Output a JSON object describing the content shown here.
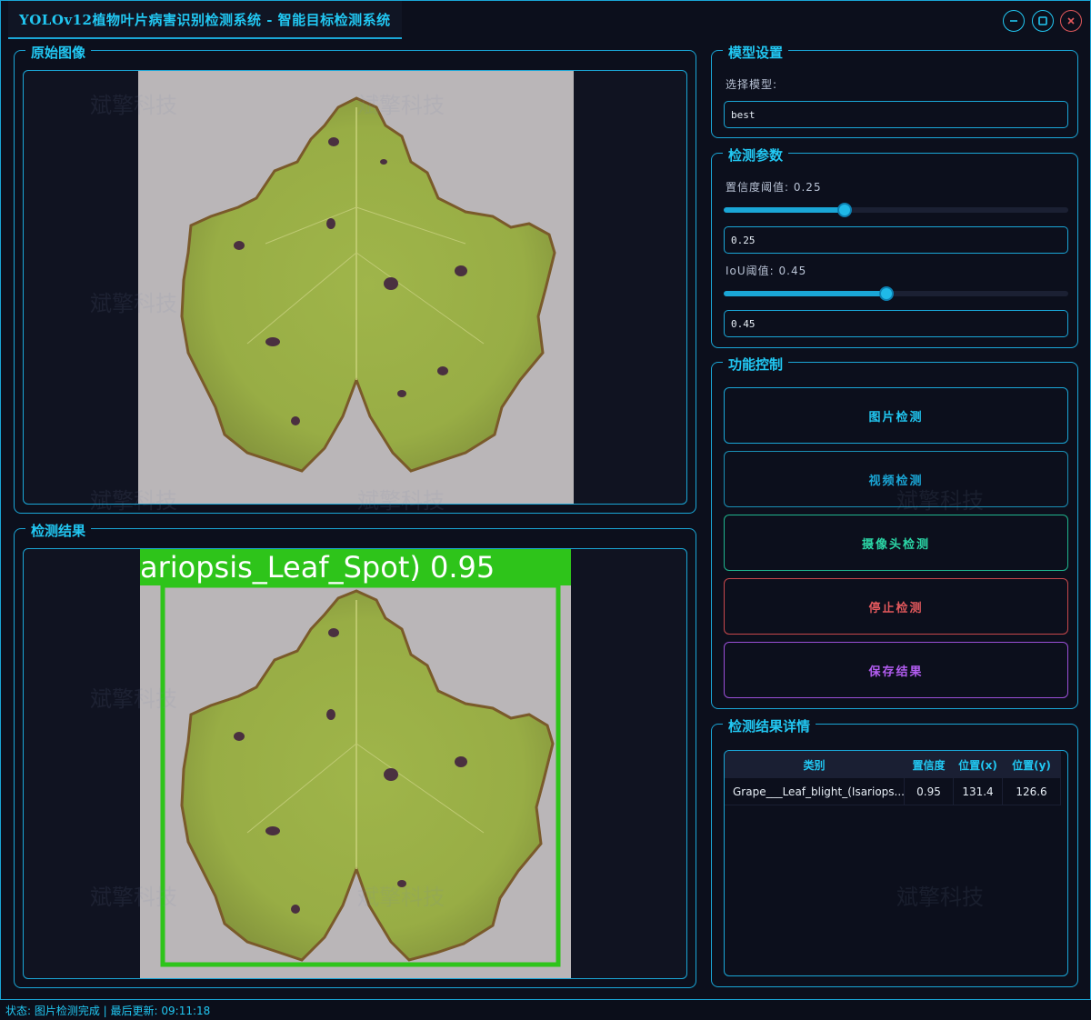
{
  "window": {
    "title": "YOLOv12植物叶片病害识别检测系统 - 智能目标检测系统"
  },
  "watermark": "斌擎科技",
  "panels": {
    "original": {
      "title": "原始图像"
    },
    "result": {
      "title": "检测结果"
    }
  },
  "detection_overlay": {
    "label": "ariopsis_Leaf_Spot) 0.95",
    "box_color": "#2ec41a"
  },
  "model_settings": {
    "title": "模型设置",
    "select_label": "选择模型:",
    "selected_model": "best"
  },
  "params": {
    "title": "检测参数",
    "confidence_label": "置信度阈值: 0.25",
    "confidence_value": "0.25",
    "confidence_level": 0.25,
    "iou_label": "IoU阈值: 0.45",
    "iou_value": "0.45",
    "iou_level": 0.45
  },
  "controls": {
    "title": "功能控制",
    "image_detect": "图片检测",
    "video_detect": "视频检测",
    "camera_detect": "摄像头检测",
    "stop_detect": "停止检测",
    "save_result": "保存结果"
  },
  "results": {
    "title": "检测结果详情",
    "columns": [
      "类别",
      "置信度",
      "位置(x)",
      "位置(y)"
    ],
    "rows": [
      [
        "Grape___Leaf_blight_(Isariops...",
        "0.95",
        "131.4",
        "126.6"
      ]
    ]
  },
  "status": "状态: 图片检测完成 | 最后更新: 09:11:18",
  "colors": {
    "accent": "#21c7f2",
    "stop": "#e2585c",
    "save": "#b25cf0",
    "camera": "#2bd6a6"
  }
}
